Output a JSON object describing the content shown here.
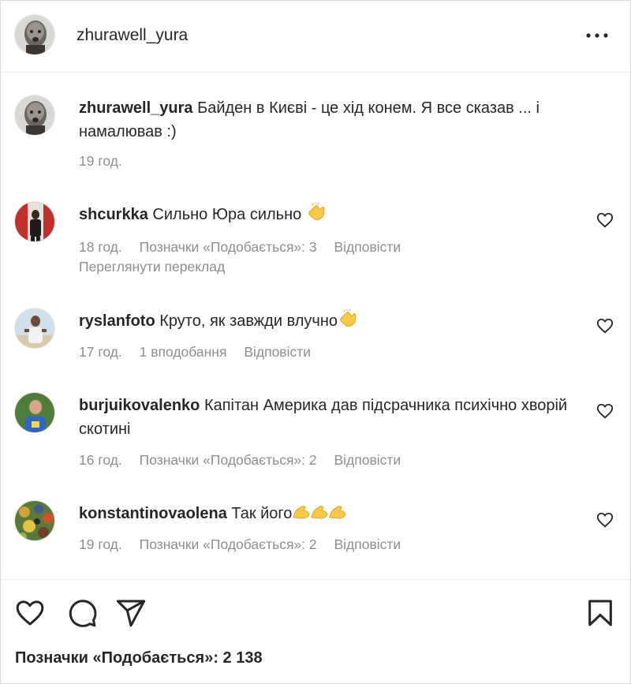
{
  "header": {
    "username": "zhurawell_yura"
  },
  "caption": {
    "username": "zhurawell_yura",
    "text": "Байден в Києві - це хід конем. Я все сказав ... і намалював :)",
    "time": "19 год."
  },
  "comments": [
    {
      "username": "shcurkka",
      "text": "Сильно Юра сильно",
      "emoji": "clapping-hands",
      "time": "18 год.",
      "likes": "Позначки «Подобається»: 3",
      "reply": "Відповісти",
      "translate": "Переглянути переклад"
    },
    {
      "username": "ryslanfoto",
      "text": "Круто, як завжди влучно",
      "emoji": "clapping-hands",
      "time": "17 год.",
      "likes": "1 вподобання",
      "reply": "Відповісти"
    },
    {
      "username": "burjuikovalenko",
      "text": "Капітан Америка дав підсрачника психічно хворій скотині",
      "time": "16 год.",
      "likes": "Позначки «Подобається»: 2",
      "reply": "Відповісти"
    },
    {
      "username": "konstantinovaolena",
      "text": "Так його",
      "emoji": "flexed-biceps x3",
      "time": "19 год.",
      "likes": "Позначки «Подобається»: 2",
      "reply": "Відповісти"
    }
  ],
  "footer": {
    "likes_total": "Позначки «Подобається»: 2 138",
    "icons": [
      "heart-icon",
      "comment-icon",
      "share-icon",
      "bookmark-icon"
    ]
  },
  "colors": {
    "text": "#262626",
    "muted": "#8e8e8e",
    "border": "#dbdbdb"
  }
}
